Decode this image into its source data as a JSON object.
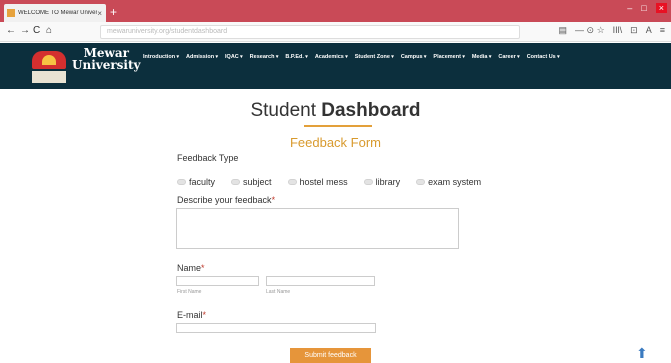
{
  "browser": {
    "tab_title": "WELCOME TO Mewar Univers",
    "tab_close": "×",
    "new_tab": "+",
    "controls": {
      "back": "←",
      "forward": "→",
      "reload": "C",
      "home": "⌂"
    },
    "url": "mewaruniversity.org/studentdashboard",
    "right_icons": [
      "▤",
      "— ⊙ ☆",
      "IIl\\",
      "⊡",
      "A",
      "≡"
    ],
    "window_controls": [
      "–",
      "□",
      "×"
    ]
  },
  "site": {
    "logo_name_line1": "Mewar",
    "logo_name_line2": "University",
    "menu": [
      "Introduction",
      "Admission",
      "IQAC",
      "Research",
      "B.P.Ed.",
      "Academics",
      "Student Zone",
      "Campus",
      "Placement",
      "Media",
      "Career",
      "Contact Us"
    ]
  },
  "page": {
    "title_light": "Student",
    "title_bold": "Dashboard",
    "form_title": "Feedback Form",
    "feedback_type_label": "Feedback Type",
    "feedback_options": [
      "faculty",
      "subject",
      "hostel mess",
      "library",
      "exam system"
    ],
    "describe_label": "Describe your feedback",
    "required_mark": "*",
    "name_label": "Name",
    "first_name_sub": "First Name",
    "last_name_sub": "Last Name",
    "email_label": "E-mail",
    "submit_label": "Submit feedback",
    "accent_color": "#e6953a",
    "header_color": "#0c2f3d"
  }
}
